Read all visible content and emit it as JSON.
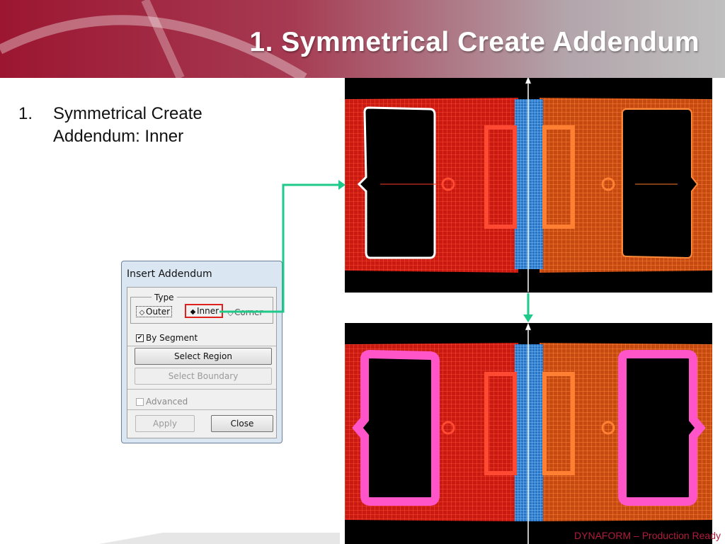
{
  "slide": {
    "title": "1. Symmetrical Create Addendum",
    "bullet_number": "1.",
    "bullet_text": "Symmetrical Create Addendum: Inner",
    "footer": "DYNAFORM – Production Ready",
    "brand_color": "#9c1631"
  },
  "dialog": {
    "title": "Insert Addendum",
    "type_group_label": "Type",
    "radio_outer": "Outer",
    "radio_inner": "Inner",
    "radio_corner": "Corner",
    "selected_type": "Inner",
    "by_segment_label": "By Segment",
    "by_segment_checked": true,
    "select_region_label": "Select Region",
    "select_boundary_label": "Select Boundary",
    "advanced_label": "Advanced",
    "advanced_checked": false,
    "apply_label": "Apply",
    "close_label": "Close"
  },
  "viewports": {
    "mesh_left_color": "#ff2a1a",
    "mesh_right_color": "#ff6a1a",
    "mesh_center_color": "#4a9fe8",
    "addendum_color": "#ff55c8",
    "arrow_color": "#1ec98a"
  }
}
